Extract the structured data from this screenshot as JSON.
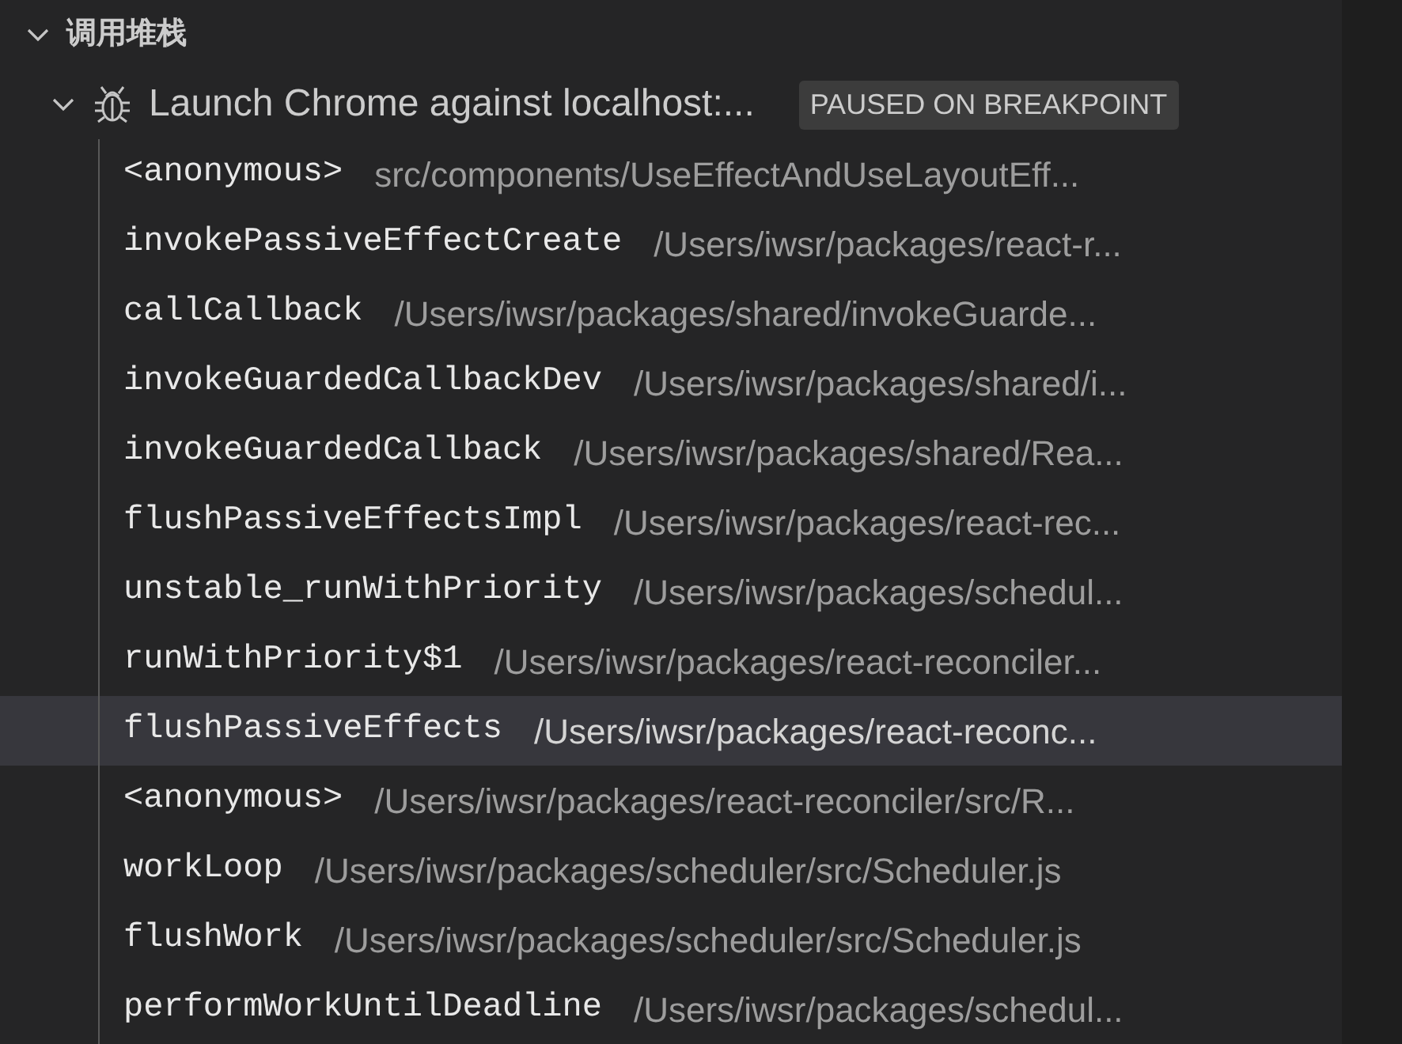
{
  "section": {
    "title": "调用堆栈",
    "expanded": true
  },
  "session": {
    "name": "Launch Chrome against localhost:...",
    "expanded": true,
    "badge": "PAUSED ON BREAKPOINT"
  },
  "frames": [
    {
      "name": "<anonymous>",
      "path": "src/components/UseEffectAndUseLayoutEff...",
      "selected": false
    },
    {
      "name": "invokePassiveEffectCreate",
      "path": "/Users/iwsr/packages/react-r...",
      "selected": false
    },
    {
      "name": "callCallback",
      "path": "/Users/iwsr/packages/shared/invokeGuarde...",
      "selected": false
    },
    {
      "name": "invokeGuardedCallbackDev",
      "path": "/Users/iwsr/packages/shared/i...",
      "selected": false
    },
    {
      "name": "invokeGuardedCallback",
      "path": "/Users/iwsr/packages/shared/Rea...",
      "selected": false
    },
    {
      "name": "flushPassiveEffectsImpl",
      "path": "/Users/iwsr/packages/react-rec...",
      "selected": false
    },
    {
      "name": "unstable_runWithPriority",
      "path": "/Users/iwsr/packages/schedul...",
      "selected": false
    },
    {
      "name": "runWithPriority$1",
      "path": "/Users/iwsr/packages/react-reconciler...",
      "selected": false
    },
    {
      "name": "flushPassiveEffects",
      "path": "/Users/iwsr/packages/react-reconc...",
      "selected": true
    },
    {
      "name": "<anonymous>",
      "path": "/Users/iwsr/packages/react-reconciler/src/R...",
      "selected": false
    },
    {
      "name": "workLoop",
      "path": "/Users/iwsr/packages/scheduler/src/Scheduler.js",
      "selected": false
    },
    {
      "name": "flushWork",
      "path": "/Users/iwsr/packages/scheduler/src/Scheduler.js",
      "selected": false
    },
    {
      "name": "performWorkUntilDeadline",
      "path": "/Users/iwsr/packages/schedul...",
      "selected": false
    }
  ]
}
